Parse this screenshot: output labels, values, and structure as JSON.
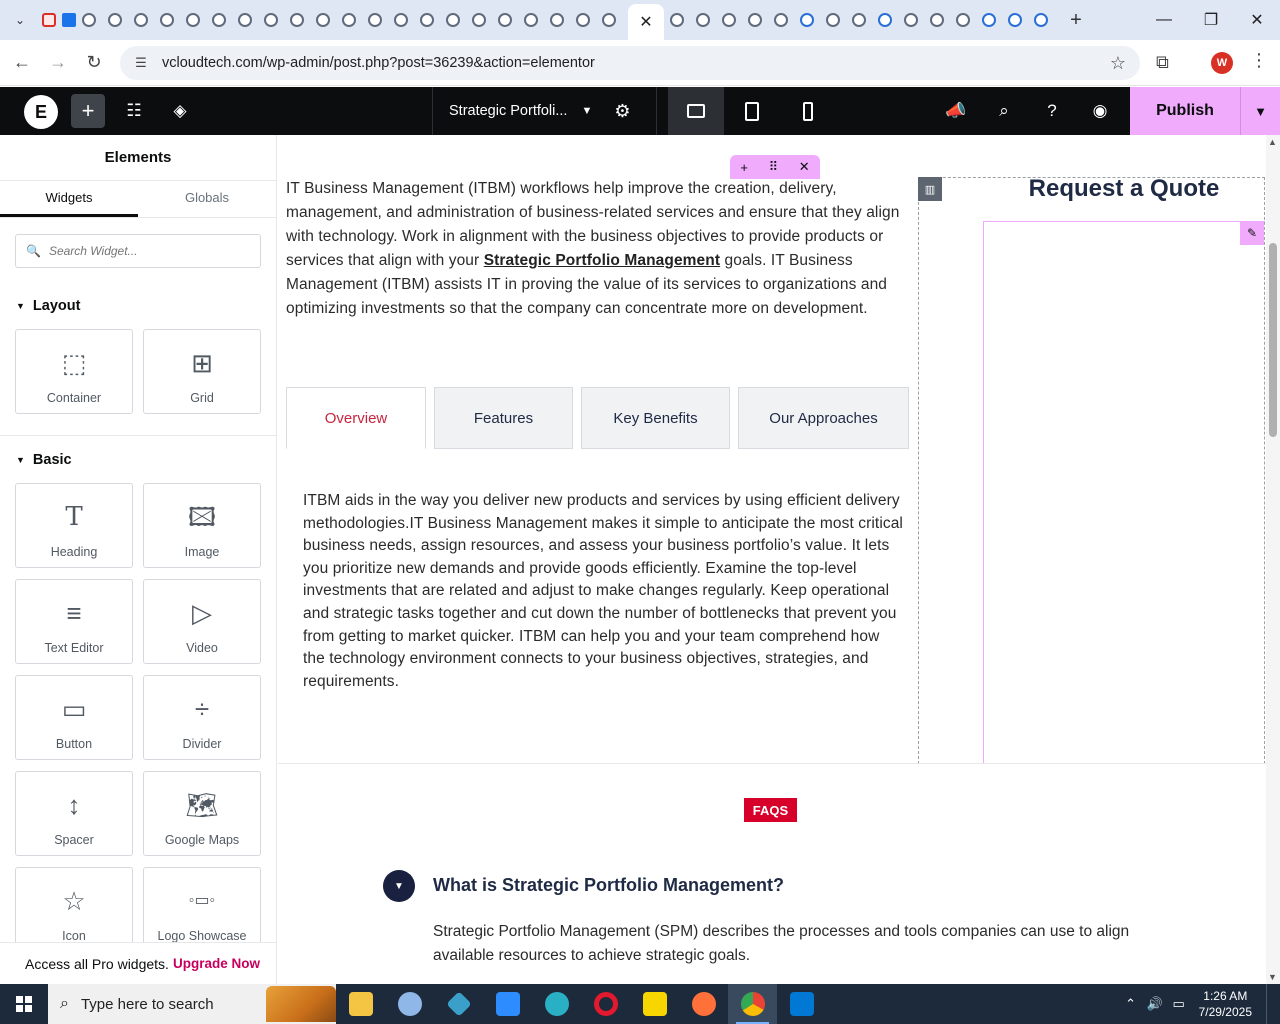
{
  "browser": {
    "active_tab_close": "✕",
    "new_tab": "+",
    "url": "vcloudtech.com/wp-admin/post.php?post=36239&action=elementor",
    "profile_initial": "W",
    "window_controls": {
      "minimize": "—",
      "restore": "❐",
      "close": "✕"
    }
  },
  "elementor_bar": {
    "logo": "E",
    "add": "+",
    "doc_title": "Strategic Portfoli...",
    "publish_label": "Publish"
  },
  "panel": {
    "title": "Elements",
    "tabs": [
      "Widgets",
      "Globals"
    ],
    "search_placeholder": "Search Widget...",
    "layout_title": "Layout",
    "layout_widgets": [
      {
        "label": "Container",
        "icon": "container-icon"
      },
      {
        "label": "Grid",
        "icon": "grid-icon"
      }
    ],
    "basic_title": "Basic",
    "basic_widgets": [
      {
        "label": "Heading",
        "icon": "heading-icon"
      },
      {
        "label": "Image",
        "icon": "image-icon"
      },
      {
        "label": "Text Editor",
        "icon": "text-editor-icon"
      },
      {
        "label": "Video",
        "icon": "video-icon"
      },
      {
        "label": "Button",
        "icon": "button-icon"
      },
      {
        "label": "Divider",
        "icon": "divider-icon"
      },
      {
        "label": "Spacer",
        "icon": "spacer-icon"
      },
      {
        "label": "Google Maps",
        "icon": "map-icon"
      },
      {
        "label": "Icon",
        "icon": "star-icon"
      },
      {
        "label": "Logo Showcase Ultimate",
        "icon": "logo-showcase-icon"
      }
    ],
    "pro_text": "Access all Pro widgets.",
    "pro_link": "Upgrade Now"
  },
  "canvas": {
    "intro_before": "IT Business Management (ITBM) workflows help improve the creation, delivery, management, and administration of business-related services and ensure that they align with technology. Work in alignment with the business objectives to provide products or services that align with your ",
    "intro_link": "Strategic Portfolio Management",
    "intro_after": " goals. IT Business Management (ITBM) assists IT in proving the value of its services to organizations and optimizing investments so that the company can concentrate more on development.",
    "tabs": [
      "Overview",
      "Features",
      "Key Benefits",
      "Our Approaches"
    ],
    "active_tab": "Overview",
    "tab_body": "ITBM aids in the way you deliver new products and services by using efficient delivery methodologies.IT Business Management makes it simple to anticipate the most critical business needs, assign resources, and assess your business portfolio’s value. It lets you prioritize new demands and provide goods efficiently. Examine the top-level investments that are related and adjust to make changes regularly. Keep operational and strategic tasks together and cut down the number of bottlenecks that prevent you from getting to market quicker. ITBM can help you and your team comprehend how the technology environment connects to your business objectives, strategies, and requirements.",
    "quote_title": "Request a Quote",
    "faqs_badge": "FAQS",
    "faq_question": "What is Strategic Portfolio Management?",
    "faq_answer": "Strategic Portfolio Management (SPM) describes the processes and tools companies can use to align available resources to achieve strategic goals."
  },
  "taskbar": {
    "search_placeholder": "Type here to search",
    "time": "1:26 AM",
    "date": "7/29/2025"
  },
  "colors": {
    "elementor_pink": "#f0abfc",
    "active_tab_red": "#c7263f",
    "faqs_red": "#d7002b",
    "navy": "#1f2a44"
  }
}
